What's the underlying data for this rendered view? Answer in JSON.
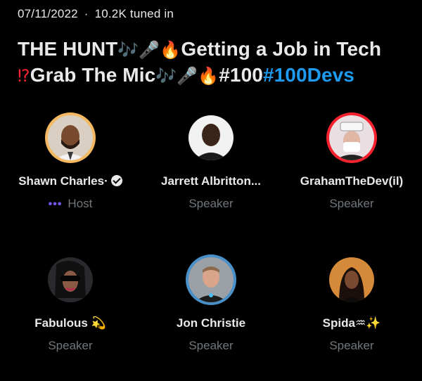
{
  "meta": {
    "date": "07/11/2022",
    "separator": "·",
    "tuned_in": "10.2K tuned in"
  },
  "title": {
    "part1": "THE HUNT",
    "emoji1": "🎶🎤🔥",
    "part2": "Getting a Job in Tech",
    "emoji2": "⁉",
    "part3": "Grab The Mic",
    "emoji3": "🎶🎤🔥",
    "part4": "#100",
    "hashtag": "#100Devs"
  },
  "participants": [
    {
      "name": "Shawn Charles·",
      "role": "Host",
      "verified": true,
      "host_dots": "•••",
      "ring": "#f4b860",
      "icon": "avatar-shawn-icon"
    },
    {
      "name": "Jarrett Albritton...",
      "role": "Speaker",
      "icon": "avatar-jarrett-icon"
    },
    {
      "name": "GrahamTheDev(il)",
      "role": "Speaker",
      "ring": "#f4212e",
      "icon": "avatar-graham-icon"
    },
    {
      "name": "Fabulous",
      "name_emoji": "💫",
      "role": "Speaker",
      "icon": "avatar-fabulous-icon"
    },
    {
      "name": "Jon Christie",
      "role": "Speaker",
      "ring": "#4a90c8",
      "icon": "avatar-jon-icon"
    },
    {
      "name": "Spida",
      "name_emoji": "♒✨",
      "role": "Speaker",
      "icon": "avatar-spida-icon"
    }
  ]
}
